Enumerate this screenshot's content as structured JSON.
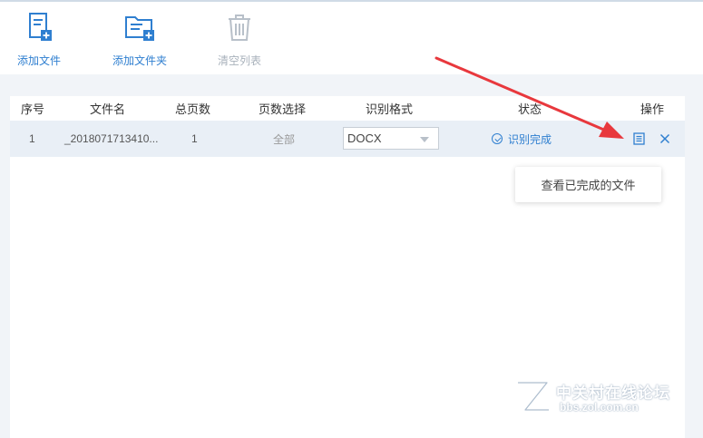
{
  "toolbar": {
    "add_file": "添加文件",
    "add_folder": "添加文件夹",
    "clear_list": "清空列表"
  },
  "table": {
    "headers": {
      "index": "序号",
      "filename": "文件名",
      "total_pages": "总页数",
      "page_select": "页数选择",
      "format": "识别格式",
      "status": "状态",
      "actions": "操作"
    },
    "rows": [
      {
        "index": "1",
        "filename": "_2018071713410...",
        "total_pages": "1",
        "page_select": "全部",
        "format": "DOCX",
        "status": "识别完成"
      }
    ]
  },
  "tooltip": {
    "text": "查看已完成的文件"
  },
  "watermark": {
    "line1": "中关村在线论坛",
    "line2": "bbs.zol.com.cn"
  },
  "colors": {
    "accent": "#2f7fd0",
    "arrow": "#e8383d",
    "disabled": "#a8b1bb",
    "row_bg": "#e9eff6",
    "page_bg": "#f1f4f8"
  },
  "icons": {
    "add_file": "add-file-icon",
    "add_folder": "add-folder-icon",
    "clear_list": "trash-icon",
    "view": "view-document-icon",
    "remove": "close-icon",
    "status": "check-circle-icon"
  }
}
